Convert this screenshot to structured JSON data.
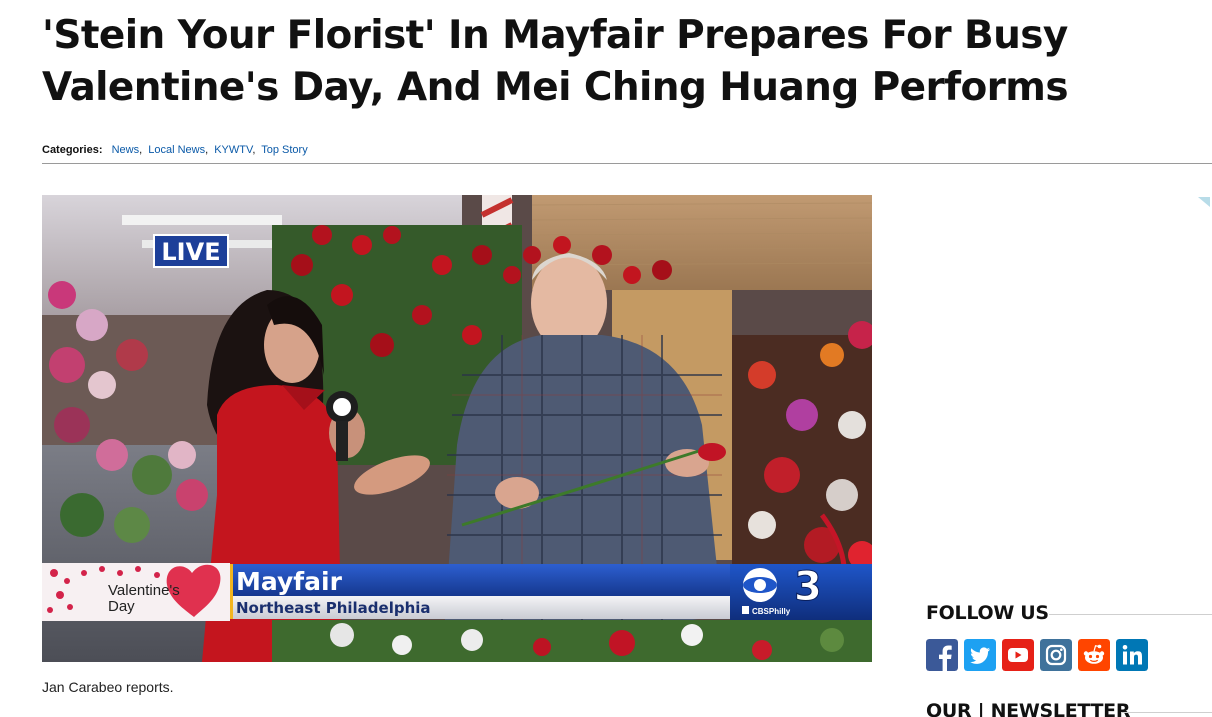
{
  "article": {
    "headline": "'Stein Your Florist' In Mayfair Prepares For Busy Valentine's Day, And Mei Ching Huang Performs",
    "categories_label": "Categories:",
    "categories": [
      "News",
      "Local News",
      "KYWTV",
      "Top Story"
    ],
    "caption": "Jan Carabeo reports."
  },
  "video": {
    "live_badge": "LIVE",
    "lower_third_location": "Mayfair",
    "lower_third_sublocation": "Northeast Philadelphia",
    "valentines_label_line1": "Valentine's",
    "valentines_label_line2": "Day",
    "station_number": "3",
    "station_handle": "CBSPhilly"
  },
  "sidebar": {
    "follow_title": "FOLLOW US",
    "newsletter_title": "OUR | NEWSLETTER",
    "social_icons": [
      "facebook-icon",
      "twitter-icon",
      "youtube-icon",
      "instagram-icon",
      "reddit-icon",
      "linkedin-icon"
    ]
  },
  "colors": {
    "link": "#0b5aa8",
    "facebook": "#3b5998",
    "twitter": "#1da1f2",
    "youtube": "#e62117",
    "instagram": "#3f729b",
    "reddit": "#ff4500",
    "linkedin": "#0077b5",
    "lower_third_blue": "#1a3f9e"
  }
}
